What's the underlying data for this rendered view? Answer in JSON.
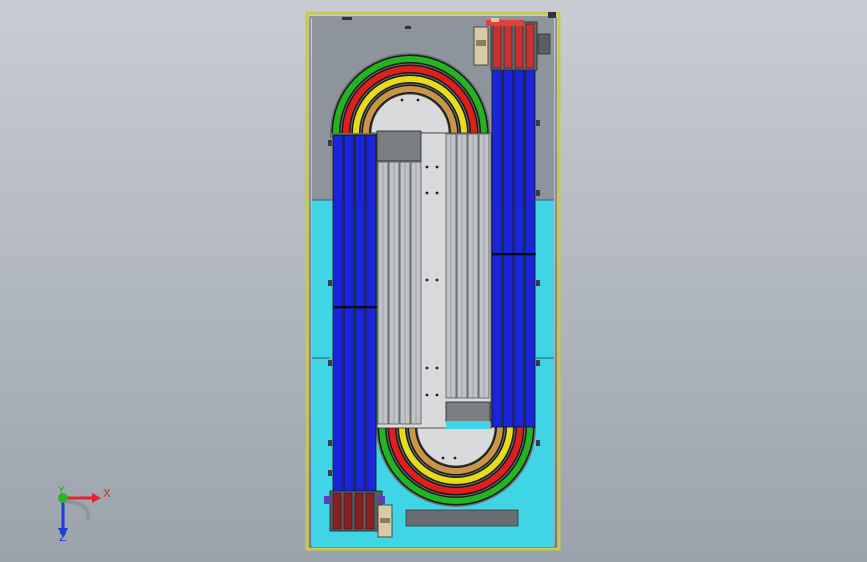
{
  "viewport": {
    "background_top": "#c9cdd3",
    "background_bottom": "#9aa2ab"
  },
  "model": {
    "frame_color": "#c8c84a",
    "upper_bed_color": "#8d949b",
    "lower_bed_color": "#3fd4e6",
    "belt_colors": [
      "#22b422",
      "#e01e1e",
      "#e6dc1e",
      "#c89646"
    ],
    "module_blue": "#1a24d8",
    "rail_gray": "#c0c4c8",
    "deck_color": "#d8dadc"
  },
  "triad": {
    "x_label": "X",
    "y_label": "Y",
    "z_label": "Z",
    "x_color": "#e0242a",
    "y_color": "#28b428",
    "z_color": "#1e3cd8"
  }
}
